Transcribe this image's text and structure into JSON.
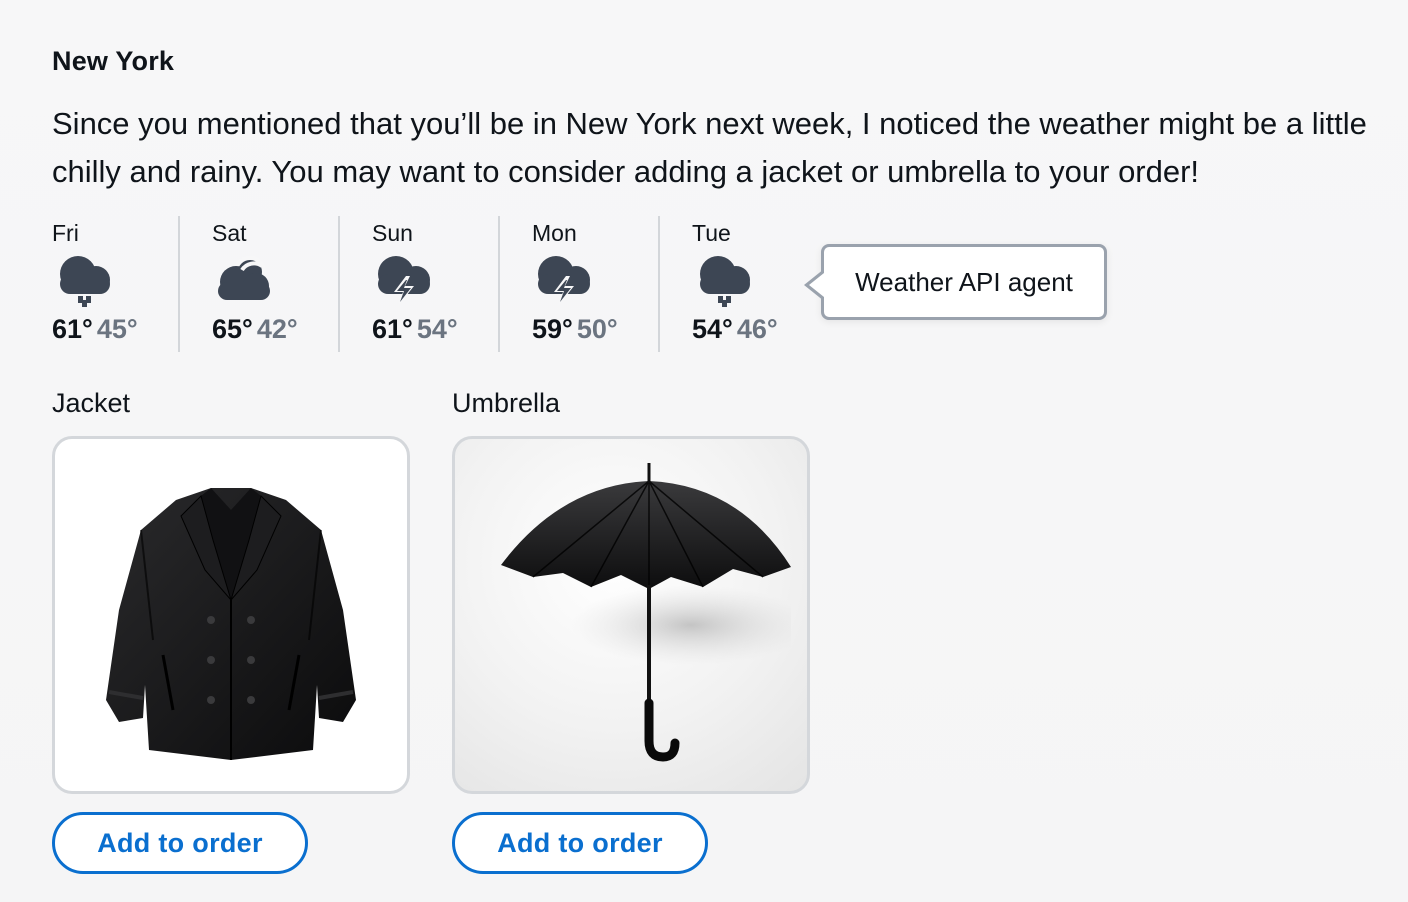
{
  "city": "New York",
  "message": "Since you mentioned that you’ll be in New York next week, I noticed the weather might be a little chilly and rainy. You may want to consider adding a jacket or umbrella to your order!",
  "forecast": [
    {
      "day": "Fri",
      "icon": "rain-cloud-icon",
      "high": "61°",
      "low": "45°"
    },
    {
      "day": "Sat",
      "icon": "partly-cloudy-icon",
      "high": "65°",
      "low": "42°"
    },
    {
      "day": "Sun",
      "icon": "thunderstorm-icon",
      "high": "61°",
      "low": "54°"
    },
    {
      "day": "Mon",
      "icon": "thunderstorm-icon",
      "high": "59°",
      "low": "50°"
    },
    {
      "day": "Tue",
      "icon": "rain-cloud-icon",
      "high": "54°",
      "low": "46°"
    }
  ],
  "tooltip": {
    "label": "Weather API agent"
  },
  "products": [
    {
      "title": "Jacket",
      "image": "jacket-image",
      "button": "Add to order"
    },
    {
      "title": "Umbrella",
      "image": "umbrella-image",
      "button": "Add to order"
    }
  ],
  "colors": {
    "accent": "#0a6fcf",
    "icon": "#3d4654",
    "muted_text": "#6b7480",
    "border": "#d4d7db"
  }
}
